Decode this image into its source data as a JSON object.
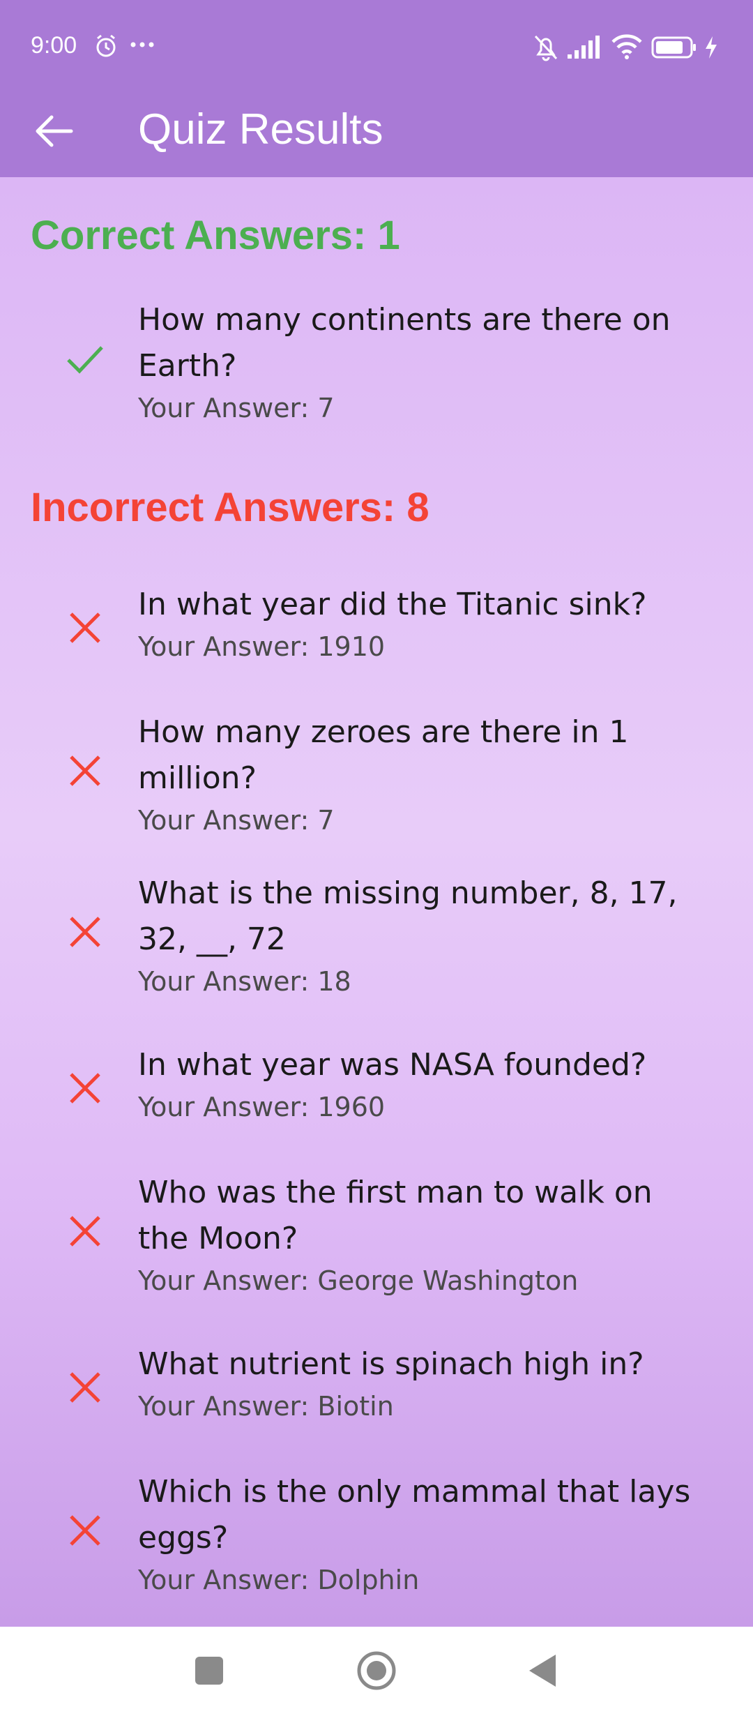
{
  "status_bar": {
    "time": "9:00",
    "icons": [
      "alarm-icon",
      "more-dots-icon",
      "mute-bell-icon",
      "signal-icon",
      "wifi-icon",
      "battery-icon",
      "charging-icon"
    ]
  },
  "app_bar": {
    "title": "Quiz Results",
    "back_icon": "arrow-left-icon"
  },
  "colors": {
    "app_bar": "#a97ad6",
    "correct": "#4caf50",
    "incorrect": "#f44336"
  },
  "correct_section": {
    "heading": "Correct Answers: 1",
    "items": [
      {
        "question": "How many continents are there on Earth?",
        "answer": "Your Answer: 7"
      }
    ]
  },
  "incorrect_section": {
    "heading": "Incorrect Answers: 8",
    "items": [
      {
        "question": "In what year did the Titanic sink?",
        "answer": "Your Answer: 1910"
      },
      {
        "question": "How many zeroes are there in 1 million?",
        "answer": "Your Answer: 7"
      },
      {
        "question": "What is the missing number, 8, 17, 32, __, 72",
        "answer": "Your Answer: 18"
      },
      {
        "question": "In what year was NASA founded?",
        "answer": "Your Answer: 1960"
      },
      {
        "question": "Who was the first man to walk on the Moon?",
        "answer": "Your Answer: George Washington"
      },
      {
        "question": "What nutrient is spinach high in?",
        "answer": "Your Answer: Biotin"
      },
      {
        "question": "Which is the only mammal that lays eggs?",
        "answer": "Your Answer: Dolphin"
      }
    ]
  },
  "nav_bar": {
    "buttons": [
      "recents-square-icon",
      "home-circle-icon",
      "back-triangle-icon"
    ]
  }
}
